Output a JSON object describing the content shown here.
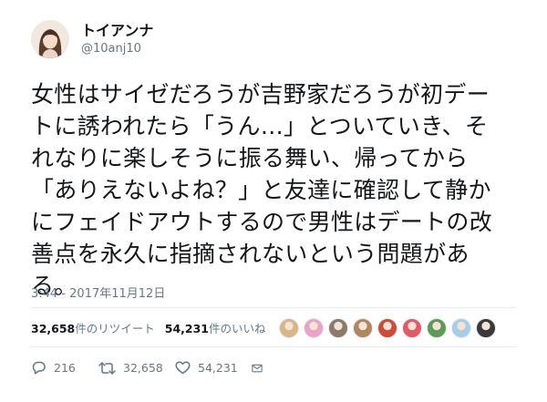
{
  "author": {
    "display_name": "トイアンナ",
    "handle": "@10anj10"
  },
  "tweet": {
    "lines": [
      "女性はサイゼだろうが吉野家だろうが初デー",
      "トに誘われたら「うん…」とついていき、そ",
      "れなりに楽しそうに振る舞い、帰ってから",
      "「ありえないよね？」と友達に確認して静か",
      "にフェイドアウトするので男性はデートの改",
      "善点を永久に指摘されないという問題があ",
      "る。"
    ],
    "timestamp": "3:44 - 2017年11月12日"
  },
  "stats": {
    "retweets_count": "32,658",
    "retweets_label": "件のリツイート",
    "likes_count": "54,231",
    "likes_label": "件のいいね"
  },
  "likers": [
    {
      "name": "liker-1",
      "color": "#d9b58a"
    },
    {
      "name": "liker-2",
      "color": "#e8a3c8"
    },
    {
      "name": "liker-3",
      "color": "#8c7a6b"
    },
    {
      "name": "liker-4",
      "color": "#b08660"
    },
    {
      "name": "liker-5",
      "color": "#c94d3a"
    },
    {
      "name": "liker-6",
      "color": "#e05a6a"
    },
    {
      "name": "liker-7",
      "color": "#5c9a58"
    },
    {
      "name": "liker-8",
      "color": "#a9cde8"
    },
    {
      "name": "liker-9",
      "color": "#3a3a3a"
    }
  ],
  "actions": {
    "reply_count": "216",
    "retweet_count": "32,658",
    "like_count": "54,231"
  },
  "icons": {
    "reply": "reply-icon",
    "retweet": "retweet-icon",
    "like": "heart-icon",
    "dm": "envelope-icon"
  }
}
